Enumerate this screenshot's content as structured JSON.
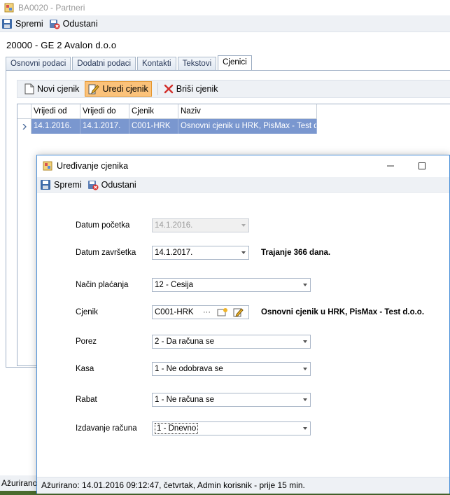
{
  "window": {
    "title": "BA0020 - Partneri"
  },
  "toolbar": {
    "save_label": "Spremi",
    "cancel_label": "Odustani"
  },
  "partner": {
    "name": "20000 - GE 2 Avalon d.o.o"
  },
  "tabs": [
    {
      "label": "Osnovni podaci"
    },
    {
      "label": "Dodatni podaci"
    },
    {
      "label": "Kontakti"
    },
    {
      "label": "Tekstovi"
    },
    {
      "label": "Cjenici",
      "active": true
    }
  ],
  "pricelist_toolbar": {
    "new_label": "Novi cjenik",
    "edit_label": "Uredi cjenik",
    "delete_label": "Briši cjenik"
  },
  "grid": {
    "columns": [
      "Vrijedi od",
      "Vrijedi do",
      "Cjenik",
      "Naziv"
    ],
    "rows": [
      [
        "14.1.2016.",
        "14.1.2017.",
        "C001-HRK",
        "Osnovni cjenik u HRK, PisMax - Test d..."
      ]
    ]
  },
  "background_status": {
    "text": "Ažurirano"
  },
  "dialog": {
    "title": "Uređivanje cjenika",
    "toolbar": {
      "save_label": "Spremi",
      "cancel_label": "Odustani"
    },
    "fields": {
      "start_date": {
        "label": "Datum početka",
        "value": "14.1.2016."
      },
      "end_date": {
        "label": "Datum završetka",
        "value": "14.1.2017."
      },
      "duration": "Trajanje 366 dana.",
      "payment": {
        "label": "Način plaćanja",
        "value": "12 - Cesija"
      },
      "pricelist": {
        "label": "Cjenik",
        "value": "C001-HRK",
        "ellipsis": "···",
        "description": "Osnovni cjenik u HRK, PisMax - Test d.o.o."
      },
      "tax": {
        "label": "Porez",
        "value": "2 - Da računa se"
      },
      "register": {
        "label": "Kasa",
        "value": "1 - Ne odobrava se"
      },
      "discount": {
        "label": "Rabat",
        "value": "1 - Ne računa se"
      },
      "invoicing": {
        "label": "Izdavanje računa",
        "value": "1 - Dnevno"
      }
    },
    "status": "Ažurirano: 14.01.2016 09:12:47, četvrtak, Admin korisnik -  prije 15 min."
  },
  "colors": {
    "selection": "#7a97cf",
    "active_button": "#fbc27a",
    "dialog_border": "#4a90d9"
  }
}
